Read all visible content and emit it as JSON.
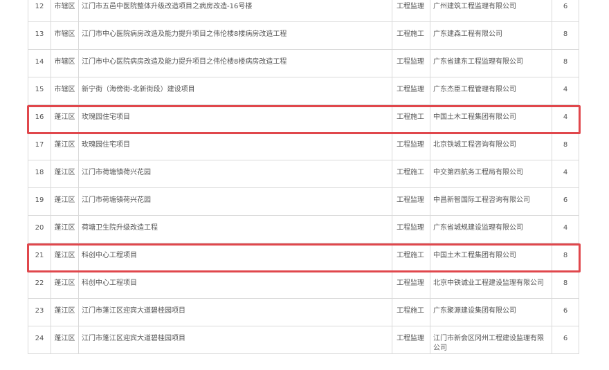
{
  "rows": [
    {
      "no": "12",
      "district": "市辖区",
      "project": "江门市五邑中医院整体升级改造项目之病房改造-16号楼",
      "type": "工程监理",
      "company": "广州建筑工程监理有限公司",
      "score": "6",
      "highlight": false
    },
    {
      "no": "13",
      "district": "市辖区",
      "project": "江门市中心医院病房改造及能力提升项目之伟伦楼8楼病房改造工程",
      "type": "工程施工",
      "company": "广东建森工程有限公司",
      "score": "8",
      "highlight": false
    },
    {
      "no": "14",
      "district": "市辖区",
      "project": "江门市中心医院病房改造及能力提升项目之伟伦楼8楼病房改造工程",
      "type": "工程监理",
      "company": "广东省建东工程监理有限公司",
      "score": "8",
      "highlight": false
    },
    {
      "no": "15",
      "district": "市辖区",
      "project": "新宁街（海傍街-北新街段）建设项目",
      "type": "工程监理",
      "company": "广东杰臣工程管理有限公司",
      "score": "4",
      "highlight": false
    },
    {
      "no": "16",
      "district": "蓬江区",
      "project": "玫瑰园住宅项目",
      "type": "工程施工",
      "company": "中国土木工程集团有限公司",
      "score": "4",
      "highlight": true
    },
    {
      "no": "17",
      "district": "蓬江区",
      "project": "玫瑰园住宅项目",
      "type": "工程监理",
      "company": "北京铁城工程咨询有限公司",
      "score": "8",
      "highlight": false
    },
    {
      "no": "18",
      "district": "蓬江区",
      "project": "江门市荷塘镇荷兴花园",
      "type": "工程施工",
      "company": "中交第四航务工程局有限公司",
      "score": "4",
      "highlight": false
    },
    {
      "no": "19",
      "district": "蓬江区",
      "project": "江门市荷塘镇荷兴花园",
      "type": "工程监理",
      "company": "中昌新智国际工程咨询有限公司",
      "score": "6",
      "highlight": false
    },
    {
      "no": "20",
      "district": "蓬江区",
      "project": "荷塘卫生院升级改造工程",
      "type": "工程监理",
      "company": "广东省城规建设监理有限公司",
      "score": "4",
      "highlight": false
    },
    {
      "no": "21",
      "district": "蓬江区",
      "project": "科创中心工程项目",
      "type": "工程施工",
      "company": "中国土木工程集团有限公司",
      "score": "8",
      "highlight": true
    },
    {
      "no": "22",
      "district": "蓬江区",
      "project": "科创中心工程项目",
      "type": "工程监理",
      "company": "北京中铁诚业工程建设监理有限公司",
      "score": "8",
      "highlight": false
    },
    {
      "no": "23",
      "district": "蓬江区",
      "project": "江门市蓬江区迎宾大道碧桂园项目",
      "type": "工程施工",
      "company": "广东聚源建设集团有限公司",
      "score": "6",
      "highlight": false
    },
    {
      "no": "24",
      "district": "蓬江区",
      "project": "江门市蓬江区迎宾大道碧桂园项目",
      "type": "工程监理",
      "company": "江门市新会区冈州工程建设监理有限公司",
      "score": "6",
      "highlight": false
    }
  ],
  "colors": {
    "highlight_border": "#e0474c",
    "grid": "#d9d9d9",
    "text": "#555555"
  }
}
